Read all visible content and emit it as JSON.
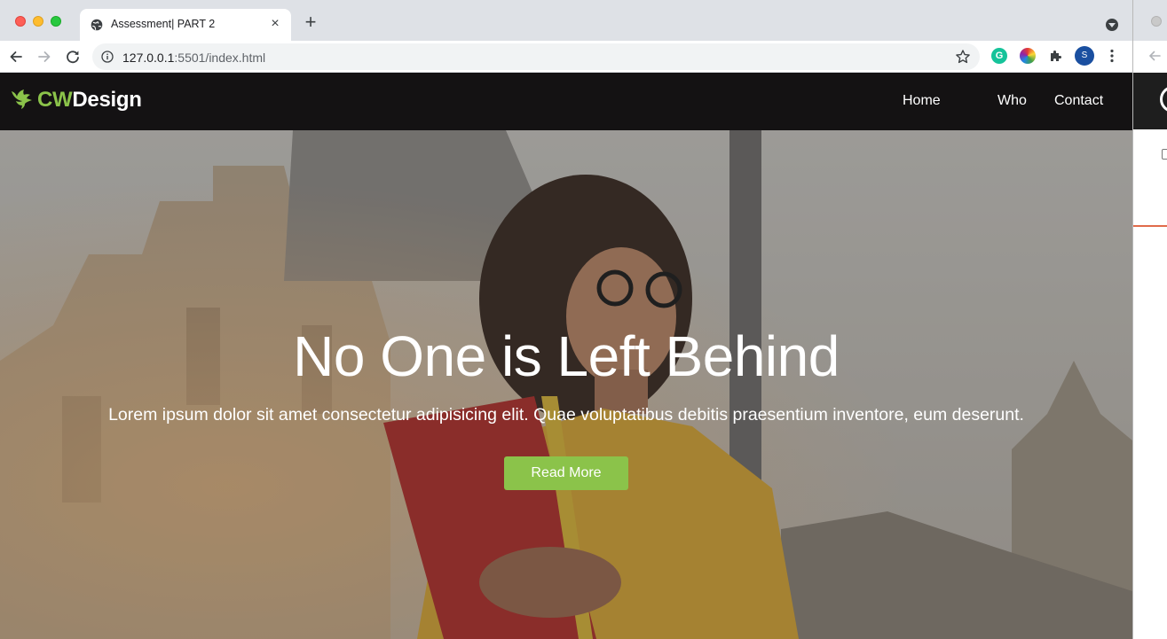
{
  "browser": {
    "tab": {
      "title": "Assessment| PART 2",
      "favicon": "globe-icon",
      "close": "×"
    },
    "new_tab": "+",
    "address": {
      "host": "127.0.0.1",
      "rest": ":5501/index.html"
    },
    "extensions": {
      "grammarly": "G",
      "profile_initial": "S"
    }
  },
  "site": {
    "logo": {
      "cw": "CW",
      "design": "Design",
      "icon": "bird-icon"
    },
    "nav": [
      {
        "label": "Home"
      },
      {
        "label": "Who"
      },
      {
        "label": "Contact"
      }
    ]
  },
  "hero": {
    "title": "No One is Left Behind",
    "subtitle": "Lorem ipsum dolor sit amet consectetur adipisicing elit. Quae voluptatibus debitis praesentium inventore, eum deserunt.",
    "button": "Read More"
  },
  "colors": {
    "accent": "#8bc34a",
    "nav_bg": "#141213",
    "chrome_bg": "#dee1e6"
  }
}
